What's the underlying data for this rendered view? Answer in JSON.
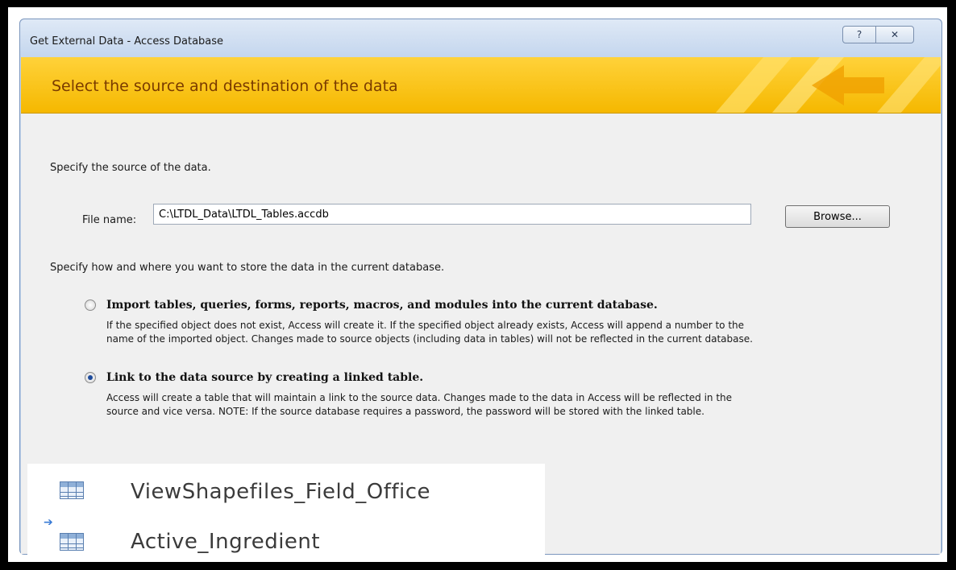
{
  "window": {
    "title": "Get External Data - Access Database",
    "help_glyph": "?",
    "close_glyph": "✕"
  },
  "banner": {
    "title": "Select the source and destination of the data"
  },
  "source": {
    "prompt": "Specify the source of the data.",
    "file_label": "File name:",
    "file_value": "C:\\LTDL_Data\\LTDL_Tables.accdb",
    "browse_label": "Browse..."
  },
  "storage": {
    "prompt": "Specify how and where you want to store the data in the current database.",
    "options": [
      {
        "title": "Import tables, queries, forms, reports, macros, and modules into the current database.",
        "desc_line1": "If the specified object does not exist, Access will create it. If the specified object already exists, Access will append a number to the",
        "desc_line2": "name of the imported object. Changes made to source objects (including data in tables) will not be reflected in the current database.",
        "checked": false
      },
      {
        "title": "Link to the data source by creating a linked table.",
        "desc_line1": "Access will create a table that will maintain a link to the source data. Changes made to the data in Access will be reflected in the",
        "desc_line2": "source and vice versa. NOTE:  If the source database requires a password, the password will be stored with the linked table.",
        "checked": true
      }
    ]
  },
  "tables": [
    {
      "name": "ViewShapefiles_Field_Office",
      "icon": "table-icon",
      "linked": false
    },
    {
      "name": "Active_Ingredient",
      "icon": "linked-table-icon",
      "linked": true
    }
  ],
  "colors": {
    "banner": "#f5b800",
    "banner_text": "#7a3b00",
    "dialog_bg": "#f0f0f0"
  }
}
